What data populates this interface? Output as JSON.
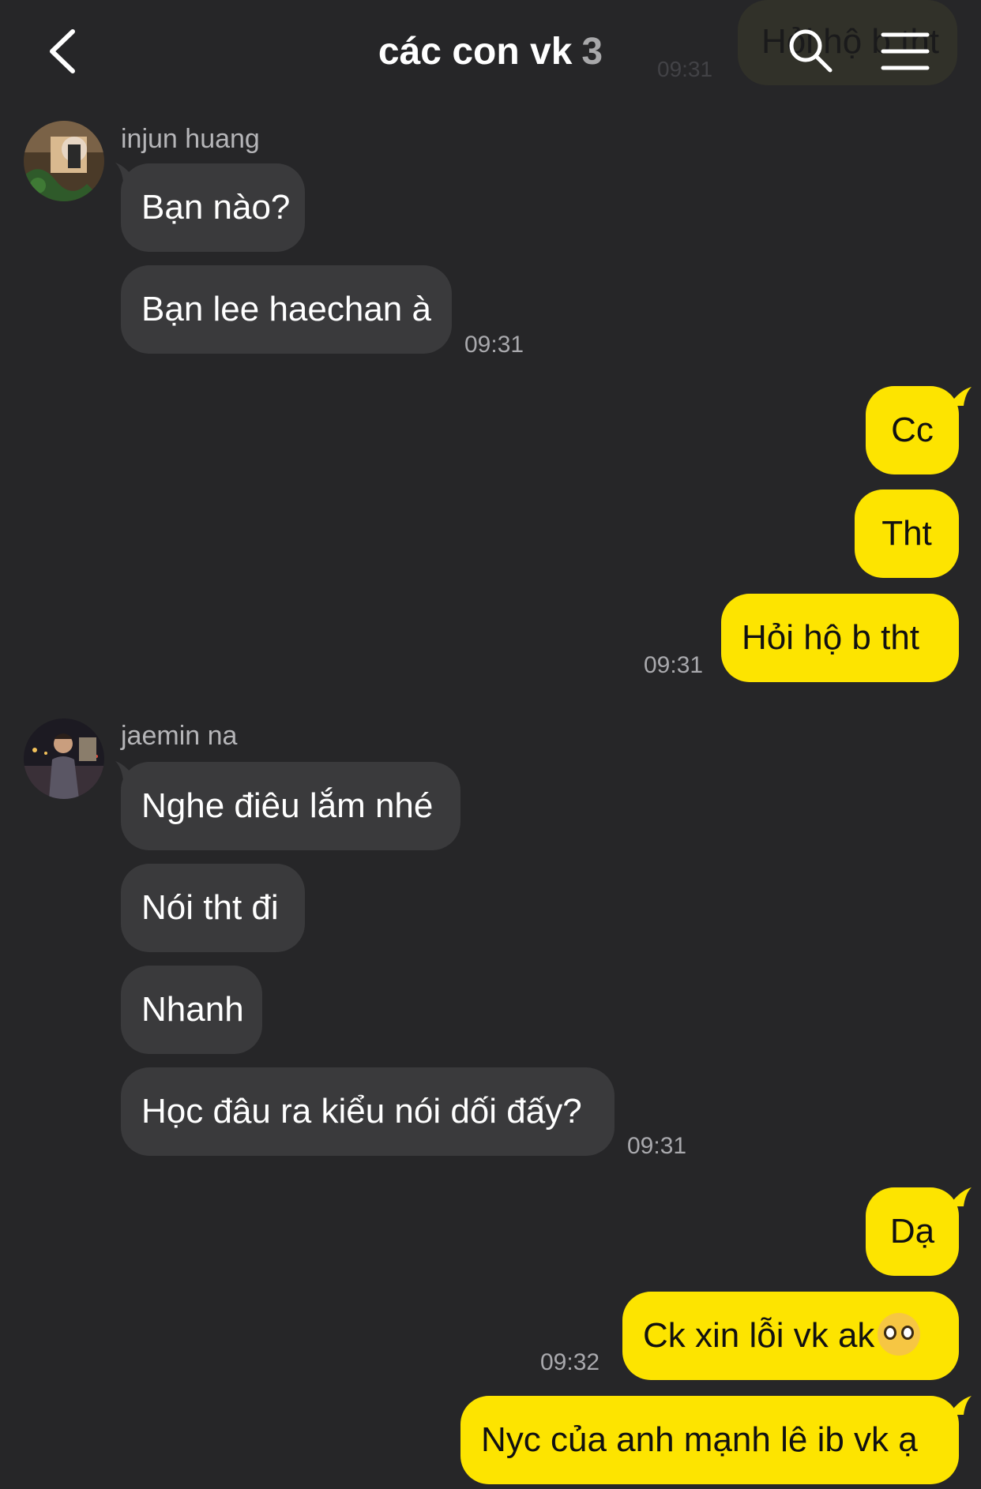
{
  "header": {
    "title": "các con vk",
    "member_count": "3",
    "ghost_bubble_text": "Hỏi hộ b tht",
    "ghost_time": "09:31",
    "back_icon": "chevron-left-icon",
    "search_icon": "search-icon",
    "menu_icon": "hamburger-menu-icon"
  },
  "messages": {
    "group1": {
      "sender": "injun huang",
      "m1": "Bạn nào?",
      "m2": "Bạn lee haechan à",
      "time": "09:31"
    },
    "group2": {
      "m1": "Cc",
      "m2": "Tht",
      "m3": "Hỏi hộ b tht",
      "time": "09:31"
    },
    "group3": {
      "sender": "jaemin na",
      "m1": "Nghe điêu lắm nhé",
      "m2": "Nói tht đi",
      "m3": "Nhanh",
      "m4": "Học đâu ra kiểu nói dối đấy?",
      "time": "09:31"
    },
    "group4": {
      "m1": "Dạ",
      "m2": "Ck xin lỗi vk ak",
      "m2_emoji": "pleading-face-emoji",
      "m3": "Nyc của anh mạnh lê ib vk ạ",
      "time": "09:32"
    }
  },
  "colors": {
    "background": "#262628",
    "incoming_bubble": "#3a3a3c",
    "outgoing_bubble": "#fde400",
    "timestamp": "#a9a9ad"
  }
}
